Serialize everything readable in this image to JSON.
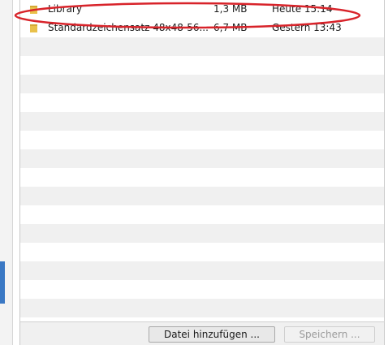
{
  "files": [
    {
      "name": "Library",
      "size": "1,3 MB",
      "date": "Heute 15:14",
      "icon": "folder-icon",
      "highlighted": true
    },
    {
      "name": "Standardzeichensatz 48x48-56...",
      "size": "6,7 MB",
      "date": "Gestern 13:43",
      "icon": "folder-icon",
      "highlighted": false
    }
  ],
  "buttons": {
    "add_file_label": "Datei hinzufügen ...",
    "save_label": "Speichern ..."
  },
  "colors": {
    "annotation": "#d8232a",
    "folder": "#e9c14a",
    "row_alt": "#f0f0f0",
    "accent": "#3a78c4"
  }
}
